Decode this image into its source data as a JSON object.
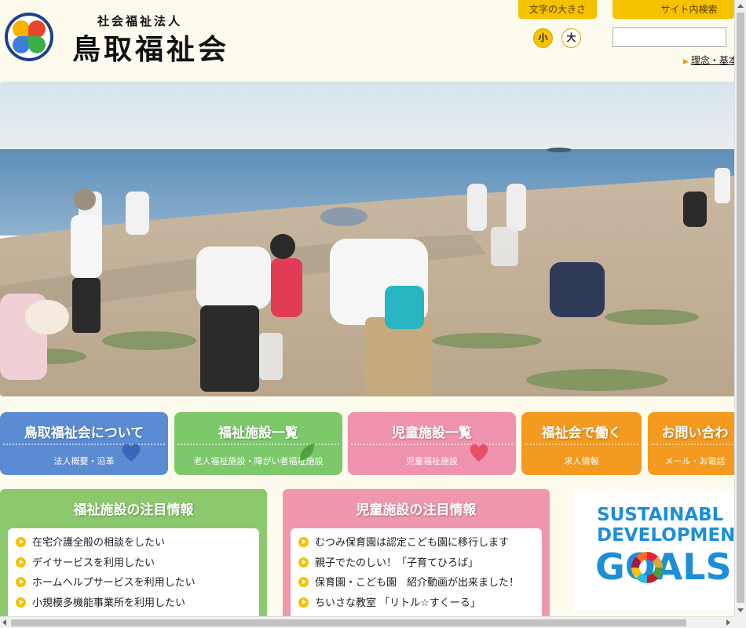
{
  "header": {
    "org_type": "社会福祉法人",
    "org_name": "鳥取福祉会",
    "font_size_label": "文字の大きさ",
    "font_small": "小",
    "font_large": "大",
    "search_label": "サイト内検索",
    "search_value": "",
    "link_philosophy": "理念・基本"
  },
  "nav": {
    "about": {
      "title": "鳥取福祉会について",
      "sub": "法人概要・沿革"
    },
    "welfare": {
      "title": "福祉施設一覧",
      "sub": "老人福祉施設・障がい者福祉施設"
    },
    "child": {
      "title": "児童施設一覧",
      "sub": "児童福祉施設"
    },
    "work": {
      "title": "福祉会で働く",
      "sub": "求人情報"
    },
    "contact": {
      "title": "お問い合わ",
      "sub": "メール・お電話"
    }
  },
  "welfare_panel": {
    "title": "福祉施設の注目情報",
    "items": [
      "在宅介護全般の相談をしたい",
      "デイサービスを利用したい",
      "ホームヘルプサービスを利用したい",
      "小規模多機能事業所を利用したい"
    ]
  },
  "child_panel": {
    "title": "児童施設の注目情報",
    "items": [
      "むつみ保育園は認定こども園に移行します",
      "親子でたのしい！「子育てひろば」",
      "保育園・こども園　紹介動画が出来ました！",
      "ちいさな教室 「リトル☆すくーる」"
    ]
  },
  "sdg": {
    "line1": "SUSTAINABL",
    "line2": "DEVELOPMENT",
    "line3": "GOALS"
  },
  "colors": {
    "accent_yellow": "#f5c200",
    "nav_blue": "#5b8bd3",
    "nav_green": "#7cc86a",
    "nav_pink": "#ef92ad",
    "nav_orange": "#f39a1f",
    "sdg_blue": "#1c8fd6"
  }
}
